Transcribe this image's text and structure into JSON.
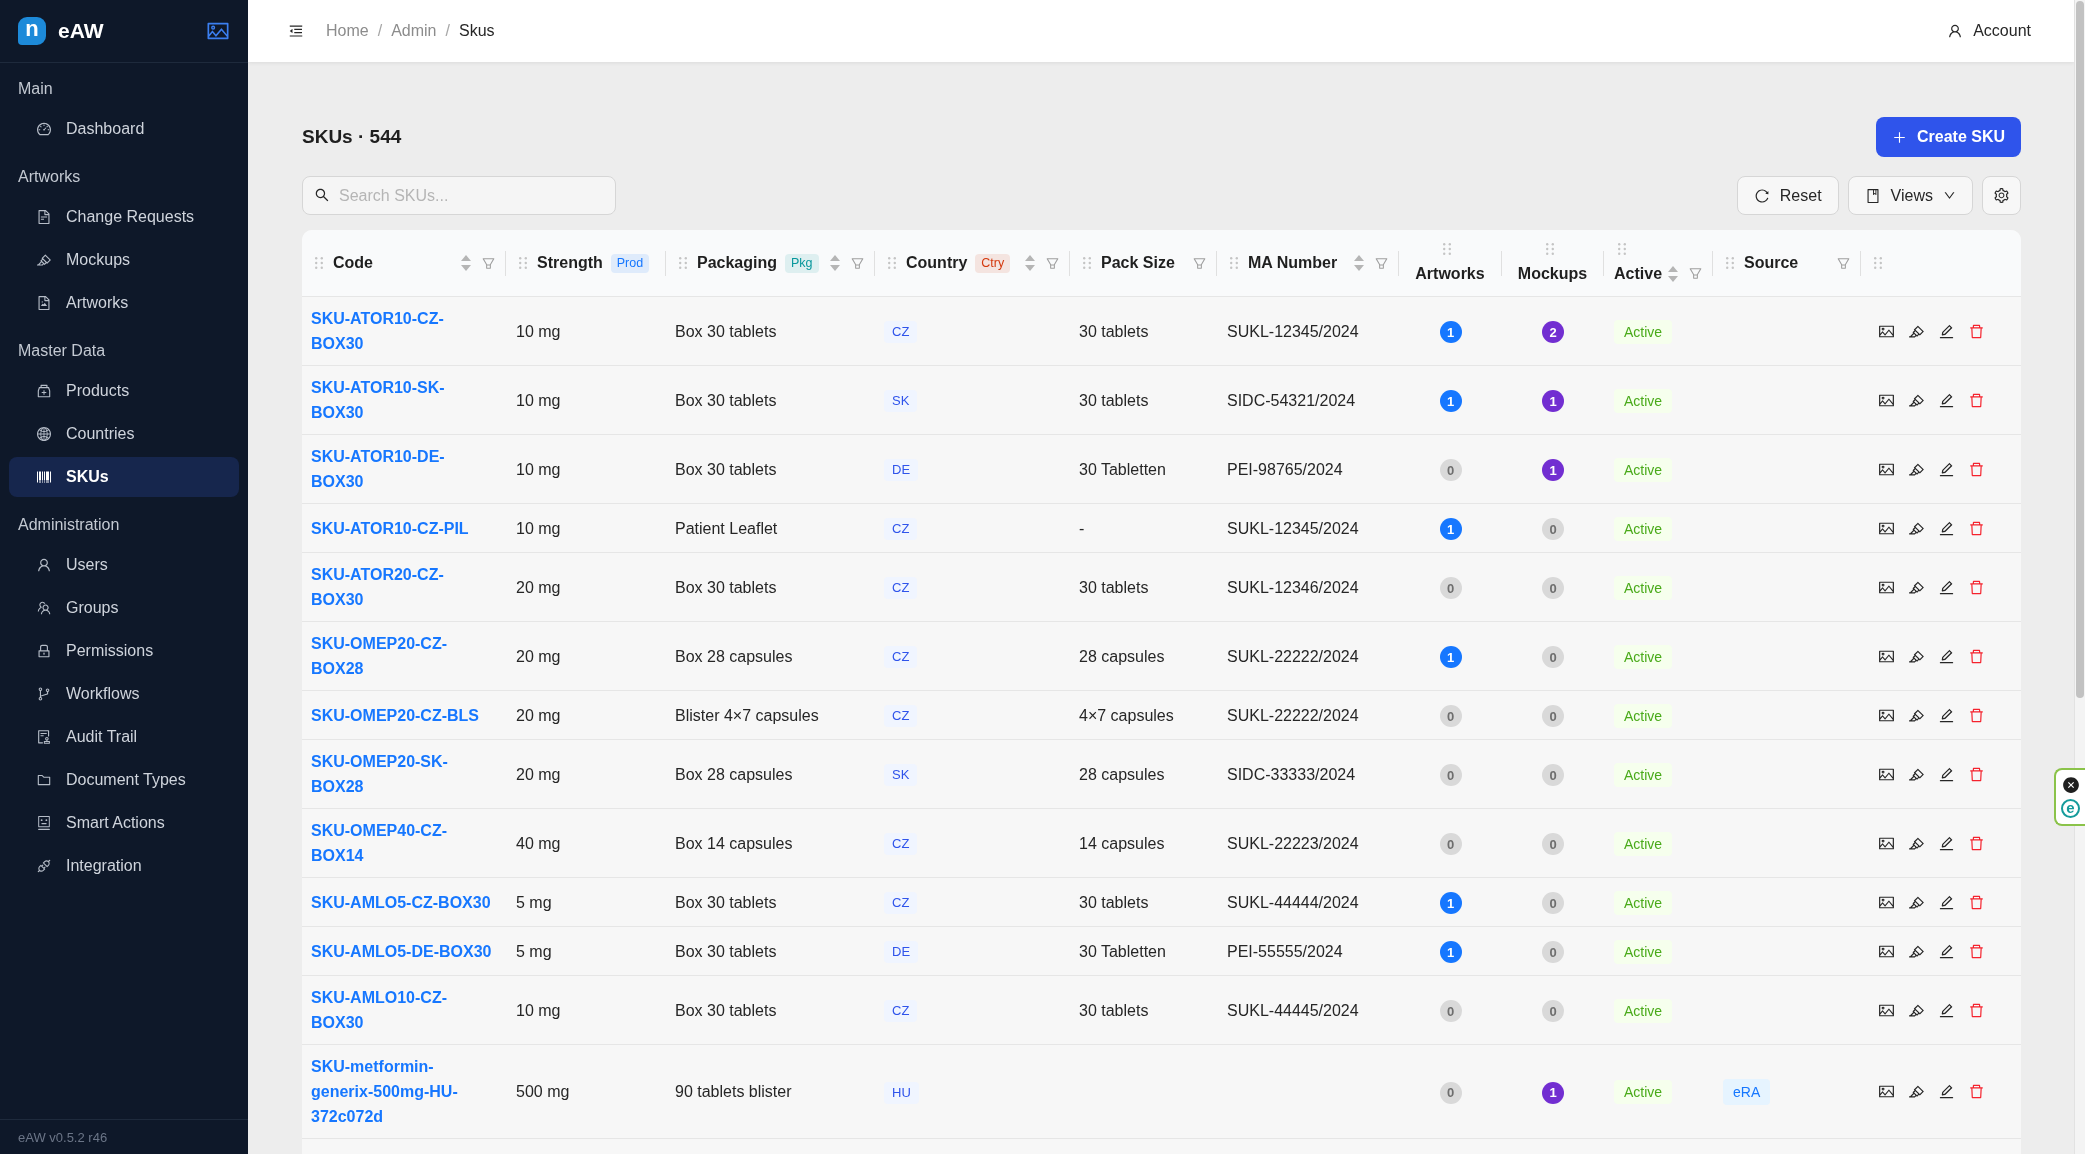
{
  "sidebar": {
    "brand": {
      "logo_letter": "n",
      "name": "eAW"
    },
    "sections": [
      {
        "title": "Main",
        "items": [
          {
            "label": "Dashboard",
            "selected": false
          }
        ]
      },
      {
        "title": "Artworks",
        "items": [
          {
            "label": "Change Requests",
            "selected": false
          },
          {
            "label": "Mockups",
            "selected": false
          },
          {
            "label": "Artworks",
            "selected": false
          }
        ]
      },
      {
        "title": "Master Data",
        "items": [
          {
            "label": "Products",
            "selected": false
          },
          {
            "label": "Countries",
            "selected": false
          },
          {
            "label": "SKUs",
            "selected": true
          }
        ]
      },
      {
        "title": "Administration",
        "items": [
          {
            "label": "Users",
            "selected": false
          },
          {
            "label": "Groups",
            "selected": false
          },
          {
            "label": "Permissions",
            "selected": false
          },
          {
            "label": "Workflows",
            "selected": false
          },
          {
            "label": "Audit Trail",
            "selected": false
          },
          {
            "label": "Document Types",
            "selected": false
          },
          {
            "label": "Smart Actions",
            "selected": false
          },
          {
            "label": "Integration",
            "selected": false
          }
        ]
      }
    ],
    "footer": "eAW v0.5.2 r46"
  },
  "top_bar": {
    "breadcrumb": {
      "items": [
        {
          "label": "Home",
          "current": false
        },
        {
          "label": "Admin",
          "current": false
        },
        {
          "label": "Skus",
          "current": true
        }
      ],
      "separators": [
        "/",
        "/"
      ]
    },
    "account": "Account"
  },
  "page": {
    "title": "SKUs · 544",
    "create_button": "Create SKU"
  },
  "toolbar": {
    "search": {
      "placeholder": "Search SKUs..."
    },
    "buttons": [
      {
        "label": "Reset",
        "kind": "button"
      },
      {
        "label": "Views",
        "kind": "dropdown"
      }
    ]
  },
  "table": {
    "columns": [
      {
        "label": "Code",
        "kind": "text",
        "sortable": true,
        "filterable": true
      },
      {
        "label": "Strength",
        "kind": "text",
        "tag": {
          "label": "Prod",
          "color": "#1677ff"
        },
        "sortable": false,
        "filterable": false
      },
      {
        "label": "Packaging",
        "kind": "text",
        "tag": {
          "label": "Pkg",
          "color": "#08979c"
        },
        "sortable": true,
        "filterable": true
      },
      {
        "label": "Country",
        "kind": "text",
        "tag": {
          "label": "Ctry",
          "color": "#d4380d"
        },
        "sortable": true,
        "filterable": true
      },
      {
        "label": "Pack Size",
        "kind": "text",
        "sortable": false,
        "filterable": true
      },
      {
        "label": "MA Number",
        "kind": "text",
        "sortable": true,
        "filterable": true
      },
      {
        "label": "Artworks",
        "kind": "count",
        "sortable": false,
        "filterable": false
      },
      {
        "label": "Mockups",
        "kind": "count",
        "sortable": false,
        "filterable": false
      },
      {
        "label": "Active",
        "kind": "status",
        "sortable": true,
        "filterable": true
      },
      {
        "label": "Source",
        "kind": "text",
        "sortable": false,
        "filterable": true
      },
      {
        "kind": "actions",
        "sortable": false,
        "filterable": false
      }
    ],
    "rows": [
      {
        "code": "SKU-ATOR10-CZ-BOX30",
        "strength": "10 mg",
        "packaging": "Box 30 tablets",
        "country": "CZ",
        "pack_size": "30 tablets",
        "ma_number": "SUKL-12345/2024",
        "artworks": {
          "value": "1",
          "color": "#1677ff"
        },
        "mockups": {
          "value": "2",
          "color": "#722ed1"
        },
        "active": {
          "label": "Active",
          "on": true
        }
      },
      {
        "code": "SKU-ATOR10-SK-BOX30",
        "strength": "10 mg",
        "packaging": "Box 30 tablets",
        "country": "SK",
        "pack_size": "30 tablets",
        "ma_number": "SIDC-54321/2024",
        "artworks": {
          "value": "1",
          "color": "#1677ff"
        },
        "mockups": {
          "value": "1",
          "color": "#722ed1"
        },
        "active": {
          "label": "Active",
          "on": true
        }
      },
      {
        "code": "SKU-ATOR10-DE-BOX30",
        "strength": "10 mg",
        "packaging": "Box 30 tablets",
        "country": "DE",
        "pack_size": "30 Tabletten",
        "ma_number": "PEI-98765/2024",
        "artworks": {
          "value": "0",
          "color": "#d9d9d9"
        },
        "mockups": {
          "value": "1",
          "color": "#722ed1"
        },
        "active": {
          "label": "Active",
          "on": true
        }
      },
      {
        "code": "SKU-ATOR10-CZ-PIL",
        "strength": "10 mg",
        "packaging": "Patient Leaflet",
        "country": "CZ",
        "pack_size": "-",
        "ma_number": "SUKL-12345/2024",
        "artworks": {
          "value": "1",
          "color": "#1677ff"
        },
        "mockups": {
          "value": "0",
          "color": "#d9d9d9"
        },
        "active": {
          "label": "Active",
          "on": true
        }
      },
      {
        "code": "SKU-ATOR20-CZ-BOX30",
        "strength": "20 mg",
        "packaging": "Box 30 tablets",
        "country": "CZ",
        "pack_size": "30 tablets",
        "ma_number": "SUKL-12346/2024",
        "artworks": {
          "value": "0",
          "color": "#d9d9d9"
        },
        "mockups": {
          "value": "0",
          "color": "#d9d9d9"
        },
        "active": {
          "label": "Active",
          "on": true
        }
      },
      {
        "code": "SKU-OMEP20-CZ-BOX28",
        "strength": "20 mg",
        "packaging": "Box 28 capsules",
        "country": "CZ",
        "pack_size": "28 capsules",
        "ma_number": "SUKL-22222/2024",
        "artworks": {
          "value": "1",
          "color": "#1677ff"
        },
        "mockups": {
          "value": "0",
          "color": "#d9d9d9"
        },
        "active": {
          "label": "Active",
          "on": true
        }
      },
      {
        "code": "SKU-OMEP20-CZ-BLS",
        "strength": "20 mg",
        "packaging": "Blister 4×7 capsules",
        "country": "CZ",
        "pack_size": "4×7 capsules",
        "ma_number": "SUKL-22222/2024",
        "artworks": {
          "value": "0",
          "color": "#d9d9d9"
        },
        "mockups": {
          "value": "0",
          "color": "#d9d9d9"
        },
        "active": {
          "label": "Active",
          "on": true
        }
      },
      {
        "code": "SKU-OMEP20-SK-BOX28",
        "strength": "20 mg",
        "packaging": "Box 28 capsules",
        "country": "SK",
        "pack_size": "28 capsules",
        "ma_number": "SIDC-33333/2024",
        "artworks": {
          "value": "0",
          "color": "#d9d9d9"
        },
        "mockups": {
          "value": "0",
          "color": "#d9d9d9"
        },
        "active": {
          "label": "Active",
          "on": true
        }
      },
      {
        "code": "SKU-OMEP40-CZ-BOX14",
        "strength": "40 mg",
        "packaging": "Box 14 capsules",
        "country": "CZ",
        "pack_size": "14 capsules",
        "ma_number": "SUKL-22223/2024",
        "artworks": {
          "value": "0",
          "color": "#d9d9d9"
        },
        "mockups": {
          "value": "0",
          "color": "#d9d9d9"
        },
        "active": {
          "label": "Active",
          "on": true
        }
      },
      {
        "code": "SKU-AMLO5-CZ-BOX30",
        "strength": "5 mg",
        "packaging": "Box 30 tablets",
        "country": "CZ",
        "pack_size": "30 tablets",
        "ma_number": "SUKL-44444/2024",
        "artworks": {
          "value": "1",
          "color": "#1677ff"
        },
        "mockups": {
          "value": "0",
          "color": "#d9d9d9"
        },
        "active": {
          "label": "Active",
          "on": true
        }
      },
      {
        "code": "SKU-AMLO5-DE-BOX30",
        "strength": "5 mg",
        "packaging": "Box 30 tablets",
        "country": "DE",
        "pack_size": "30 Tabletten",
        "ma_number": "PEI-55555/2024",
        "artworks": {
          "value": "1",
          "color": "#1677ff"
        },
        "mockups": {
          "value": "0",
          "color": "#d9d9d9"
        },
        "active": {
          "label": "Active",
          "on": true
        }
      },
      {
        "code": "SKU-AMLO10-CZ-BOX30",
        "strength": "10 mg",
        "packaging": "Box 30 tablets",
        "country": "CZ",
        "pack_size": "30 tablets",
        "ma_number": "SUKL-44445/2024",
        "artworks": {
          "value": "0",
          "color": "#d9d9d9"
        },
        "mockups": {
          "value": "0",
          "color": "#d9d9d9"
        },
        "active": {
          "label": "Active",
          "on": true
        }
      },
      {
        "code": "SKU-metformin-generix-500mg-HU-372c072d",
        "strength": "500 mg",
        "packaging": "90 tablets blister",
        "country": "HU",
        "artworks": {
          "value": "0",
          "color": "#d9d9d9"
        },
        "mockups": {
          "value": "1",
          "color": "#722ed1"
        },
        "active": {
          "label": "Active",
          "on": true
        },
        "source": "eRA"
      }
    ]
  },
  "extension": {
    "letter": "e"
  }
}
